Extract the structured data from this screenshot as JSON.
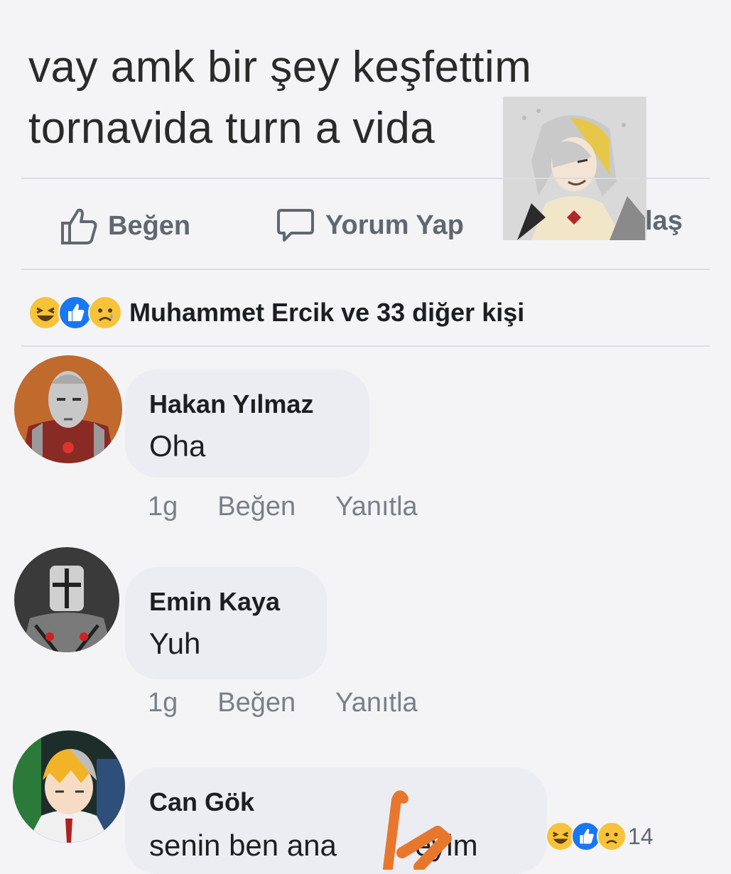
{
  "post": {
    "line1": "vay amk bir şey keşfettim",
    "line2": "tornavida turn a vida"
  },
  "actions": {
    "like": "Beğen",
    "comment": "Yorum Yap",
    "share_partial": "laş"
  },
  "reactions": {
    "summary": "Muhammet Ercik ve 33 diğer kişi",
    "icons": [
      "haha-icon",
      "like-icon",
      "sad-icon"
    ]
  },
  "comments": [
    {
      "name": "Hakan Yılmaz",
      "text": "Oha",
      "time": "1g",
      "like": "Beğen",
      "reply": "Yanıtla"
    },
    {
      "name": "Emin Kaya",
      "text": "Yuh",
      "time": "1g",
      "like": "Beğen",
      "reply": "Yanıtla"
    },
    {
      "name": "Can Gök",
      "text": "senin ben ana",
      "text_end": "eyim",
      "reaction_count": "14"
    }
  ],
  "colors": {
    "background": "#f4f4f6",
    "bubble": "#ebedf2",
    "like_blue": "#1877f2",
    "emoji_yellow": "#f7c33a",
    "scribble_orange": "#e8772e"
  }
}
